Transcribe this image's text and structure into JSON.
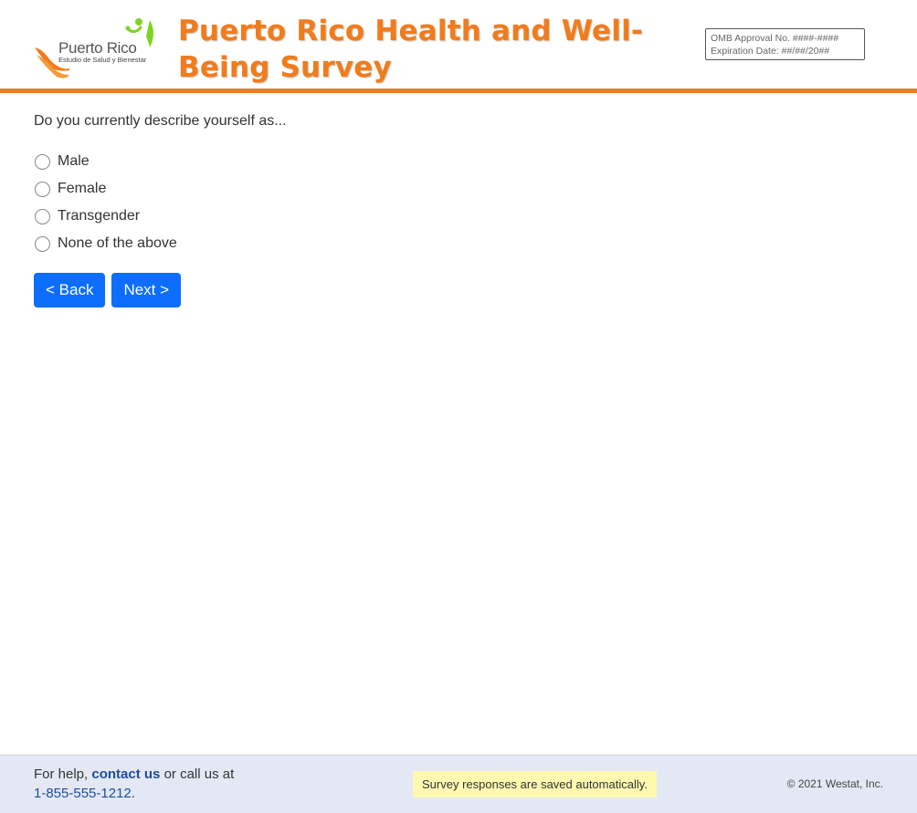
{
  "header": {
    "logo_name": "Puerto Rico",
    "logo_tagline": "Estudio de Salud y Bienestar",
    "title": "Puerto Rico Health and Well-Being Survey",
    "omb_approval": "OMB Approval No. ####-####",
    "expiration": "Expiration Date: ##/##/20##"
  },
  "question": {
    "text": "Do you currently describe yourself as...",
    "options": [
      {
        "label": "Male",
        "selected": false
      },
      {
        "label": "Female",
        "selected": false
      },
      {
        "label": "Transgender",
        "selected": false
      },
      {
        "label": "None of the above",
        "selected": false
      }
    ]
  },
  "navigation": {
    "back_label": "< Back",
    "next_label": "Next >"
  },
  "footer": {
    "help_prefix": "For help,",
    "contact_link": "contact us",
    "help_middle": "or call us at",
    "phone": "1-855-555-1212",
    "phone_suffix": ".",
    "saved_notice": "Survey responses are saved automatically.",
    "copyright": "© 2021 Westat, Inc."
  },
  "colors": {
    "accent_orange": "#f07c1d",
    "button_blue": "#0d6efd",
    "footer_bg": "#e3e8f4",
    "notice_bg": "#fff9b0",
    "logo_green": "#7ed321"
  }
}
